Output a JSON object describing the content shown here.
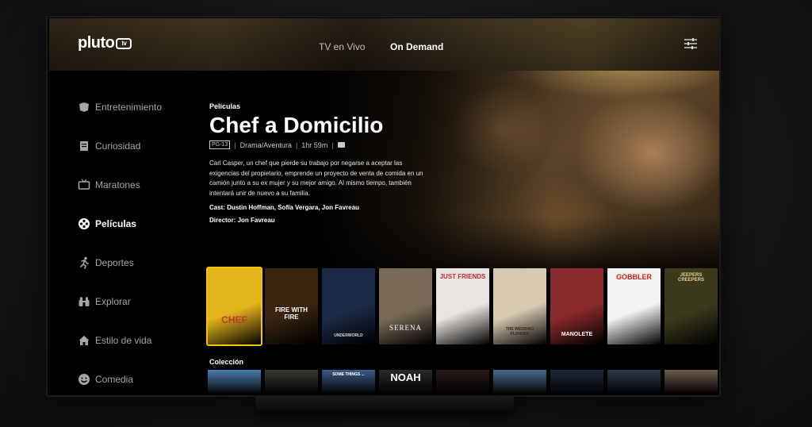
{
  "app": {
    "brand": "pluto",
    "brand_suffix": "tv"
  },
  "nav": {
    "tabs": [
      {
        "label": "TV en Vivo",
        "active": false
      },
      {
        "label": "On Demand",
        "active": true
      }
    ]
  },
  "sidebar": {
    "items": [
      {
        "label": "Entretenimiento",
        "icon": "entertainment-icon",
        "active": false
      },
      {
        "label": "Curiosidad",
        "icon": "book-icon",
        "active": false
      },
      {
        "label": "Maratones",
        "icon": "tv-icon",
        "active": false
      },
      {
        "label": "Películas",
        "icon": "film-reel-icon",
        "active": true
      },
      {
        "label": "Deportes",
        "icon": "runner-icon",
        "active": false
      },
      {
        "label": "Explorar",
        "icon": "binoculars-icon",
        "active": false
      },
      {
        "label": "Estilo de vida",
        "icon": "home-icon",
        "active": false
      },
      {
        "label": "Comedia",
        "icon": "smiley-icon",
        "active": false
      }
    ]
  },
  "details": {
    "category": "Películas",
    "title": "Chef a Domicilio",
    "rating": "PG-13",
    "genre": "Drama/Aventura",
    "duration": "1hr 59m",
    "synopsis": "Carl Casper, un chef que pierde su trabajo por negarse a aceptar las exigencias del propietario, emprende un proyecto de venta de comida en un camión junto a su ex mujer y su mejor amigo. Al mismo tiempo, también intentará unir de nuevo a su familia.",
    "cast": "Cast: Dustin Hoffman, Sofía Vergara, Jon Favreau",
    "director": "Director: Jon Favreau"
  },
  "posters": [
    {
      "label": "CHEF",
      "selected": true,
      "bg": "#e3b41c",
      "fg": "#c0392b"
    },
    {
      "label": "FIRE WITH FIRE",
      "selected": false,
      "bg": "#3a2410",
      "fg": "#ffffff"
    },
    {
      "label": "UNDERWORLD",
      "selected": false,
      "bg": "#1b2a48",
      "fg": "#cfd8e6"
    },
    {
      "label": "SERENA",
      "selected": false,
      "bg": "#7a6a55",
      "fg": "#ffffff"
    },
    {
      "label": "JUST FRIENDS",
      "selected": false,
      "bg": "#e8e4df",
      "fg": "#d0252b"
    },
    {
      "label": "THE WEDDING PLANNER",
      "selected": false,
      "bg": "#d7c9b0",
      "fg": "#3a2a1a"
    },
    {
      "label": "MANOLETE",
      "selected": false,
      "bg": "#8a2a2a",
      "fg": "#ffffff"
    },
    {
      "label": "GOBBLER",
      "selected": false,
      "bg": "#f2f2f2",
      "fg": "#c82020"
    },
    {
      "label": "JEEPERS CREEPERS",
      "selected": false,
      "bg": "#3b3a1c",
      "fg": "#e0d090"
    }
  ],
  "collection": {
    "label": "Colección",
    "items": [
      {
        "label": "",
        "bg": "#4b7fb0"
      },
      {
        "label": "",
        "bg": "#3a3a30"
      },
      {
        "label": "SOME THINGS ...",
        "bg": "#3a5a8a"
      },
      {
        "label": "NOAH",
        "bg": "#2a2a2a"
      },
      {
        "label": "",
        "bg": "#2a1a1a"
      },
      {
        "label": "",
        "bg": "#4a6a8a"
      },
      {
        "label": "",
        "bg": "#1e2a3a"
      },
      {
        "label": "",
        "bg": "#2a3a4a"
      },
      {
        "label": "",
        "bg": "#6a5a4a"
      }
    ]
  }
}
